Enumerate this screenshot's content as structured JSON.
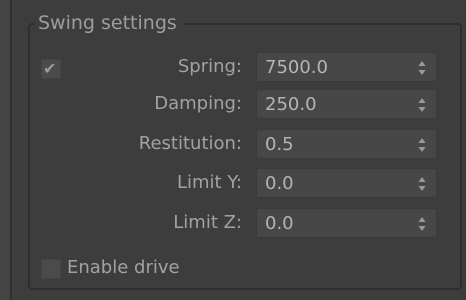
{
  "group": {
    "title": "Swing settings"
  },
  "swing_enabled": true,
  "icons": {
    "checkbox_tick": "✔",
    "spinner": "up-down-arrows-icon"
  },
  "fields": {
    "spring": {
      "label": "Spring:",
      "value": "7500.0"
    },
    "damping": {
      "label": "Damping:",
      "value": "250.0"
    },
    "restitution": {
      "label": "Restitution:",
      "value": "0.5"
    },
    "limit_y": {
      "label": "Limit Y:",
      "value": "0.0"
    },
    "limit_z": {
      "label": "Limit Z:",
      "value": "0.0"
    }
  },
  "enable_drive": {
    "label": "Enable drive",
    "checked": false
  },
  "colors": {
    "background": "#3d3d3d",
    "field_background": "#474747",
    "text": "#a2a2a2",
    "value_text": "#b4b4b4"
  }
}
